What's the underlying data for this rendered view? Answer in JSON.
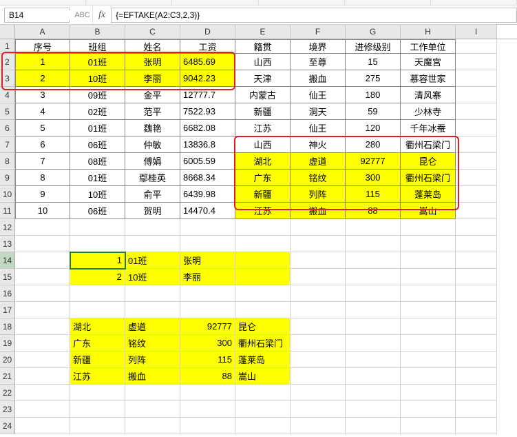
{
  "top_strip_hints": [
    "",
    "",
    "",
    "",
    "",
    ""
  ],
  "name_box": "B14",
  "abc_label": "ABC",
  "fx_label": "fx",
  "formula": "{=EFTAKE(A2:C3,2,3)}",
  "columns": [
    "A",
    "B",
    "C",
    "D",
    "E",
    "F",
    "G",
    "H",
    "I"
  ],
  "row_count": 24,
  "row_h1": 21,
  "row_hn": 24,
  "headers": [
    "序号",
    "班组",
    "姓名",
    "工资",
    "籍贯",
    "境界",
    "进修级别",
    "工作单位"
  ],
  "rows": [
    [
      "1",
      "01班",
      "张明",
      "6485.69",
      "山西",
      "至尊",
      "15",
      "天魔宫"
    ],
    [
      "2",
      "10班",
      "李丽",
      "9042.23",
      "天津",
      "搬血",
      "275",
      "慕容世家"
    ],
    [
      "3",
      "09班",
      "金平",
      "12777.7",
      "内蒙古",
      "仙王",
      "180",
      "清风寨"
    ],
    [
      "4",
      "02班",
      "范平",
      "7522.93",
      "新疆",
      "洞天",
      "59",
      "少林寺"
    ],
    [
      "5",
      "01班",
      "魏艳",
      "6682.08",
      "江苏",
      "仙王",
      "120",
      "千年冰蚕"
    ],
    [
      "6",
      "06班",
      "仲敏",
      "13836.8",
      "山西",
      "神火",
      "280",
      "衢州石梁门"
    ],
    [
      "7",
      "08班",
      "傅娟",
      "6005.59",
      "湖北",
      "虚道",
      "92777",
      "昆仑"
    ],
    [
      "8",
      "01班",
      "鄢桂英",
      "8668.34",
      "广东",
      "铭纹",
      "300",
      "衢州石梁门"
    ],
    [
      "9",
      "10班",
      "俞平",
      "6439.98",
      "新疆",
      "列阵",
      "115",
      "蓬莱岛"
    ],
    [
      "10",
      "06班",
      "贺明",
      "14470.4",
      "江苏",
      "搬血",
      "88",
      "嵩山"
    ]
  ],
  "yellow_rows_AD": [
    0,
    1
  ],
  "yellow_rows_EH": [
    6,
    7,
    8,
    9
  ],
  "block14": [
    [
      "1",
      "01班",
      "张明",
      ""
    ],
    [
      "2",
      "10班",
      "李丽",
      ""
    ]
  ],
  "block18": [
    [
      "湖北",
      "虚道",
      "92777",
      "昆仑"
    ],
    [
      "广东",
      "铭纹",
      "300",
      "衢州石梁门"
    ],
    [
      "新疆",
      "列阵",
      "115",
      "蓬莱岛"
    ],
    [
      "江苏",
      "搬血",
      "88",
      "嵩山"
    ]
  ],
  "active_cell_row": 14,
  "active_cell_col": "B"
}
